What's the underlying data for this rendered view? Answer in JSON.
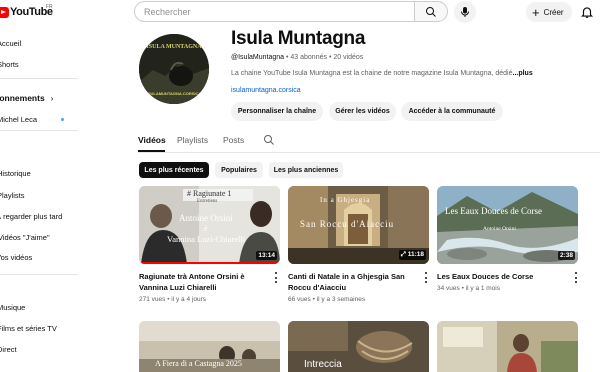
{
  "header": {
    "logo_text": "YouTube",
    "logo_region": "FR",
    "search_placeholder": "Rechercher",
    "create_label": "Créer"
  },
  "sidebar": {
    "items": [
      {
        "label": "Accueil"
      },
      {
        "label": "Shorts"
      }
    ],
    "section_label": "Abonnements",
    "subscription": {
      "label": "Michel Leca"
    },
    "you_items": [
      {
        "label": "Historique"
      },
      {
        "label": "Playlists"
      },
      {
        "label": "À regarder plus tard"
      },
      {
        "label": "Vidéos \"J'aime\""
      },
      {
        "label": "Vos vidéos"
      }
    ],
    "explore_items": [
      {
        "label": "Musique"
      },
      {
        "label": "Films et séries TV"
      },
      {
        "label": "Direct"
      }
    ]
  },
  "channel": {
    "name": "Isula Muntagna",
    "handle": "@IsulaMuntagna",
    "subscribers": "43 abonnés",
    "videos_count": "20 vidéos",
    "description": "La chaine YouTube Isula Muntagna est la chaine de notre magazine Isula Muntagna, dédié",
    "more": "...plus",
    "link": "isulamuntagna.corsica",
    "buttons": {
      "customize": "Personnaliser la chaîne",
      "manage": "Gérer les vidéos",
      "community": "Accéder à la communauté"
    },
    "avatar_title": "ISULA MUNTAGNA",
    "avatar_url_text": "ISULAMUNTAGNA.CORSICA"
  },
  "tabs": {
    "videos": "Vidéos",
    "playlists": "Playlists",
    "posts": "Posts"
  },
  "chips": {
    "recent": "Les plus récentes",
    "popular": "Populaires",
    "oldest": "Les plus anciennes"
  },
  "videos": [
    {
      "title": "Ragiunate trà Antone Orsini è Vannina Luzi Chiarelli",
      "views": "271 vues",
      "age": "il y a 4 jours",
      "duration": "13:14",
      "overlay_tag": "# Ragiunate 1",
      "overlay_sub": "Entretiens",
      "overlay_name1": "Antoine Orsini",
      "overlay_and": "è",
      "overlay_name2": "Vannina Luzi-Chiarelli"
    },
    {
      "title": "Canti di Natale in a Ghjesgia San Roccu d'Aiacciu",
      "views": "66 vues",
      "age": "il y a 3 semaines",
      "duration": "11:18",
      "overlay_top": "In a Ghjesgia",
      "overlay_bottom": "San Roccu d'Aiacciu"
    },
    {
      "title": "Les Eaux Douces de Corse",
      "views": "34 vues",
      "age": "il y a 1 mois",
      "duration": "2:38",
      "overlay_title": "Les Eaux Douces de Corse",
      "overlay_sub": "Antoine Orsini"
    },
    {
      "overlay_text": "A Fiera di a Castagna 2025"
    },
    {
      "overlay_text": "Intreccia"
    },
    {}
  ],
  "meta_sep": "•"
}
